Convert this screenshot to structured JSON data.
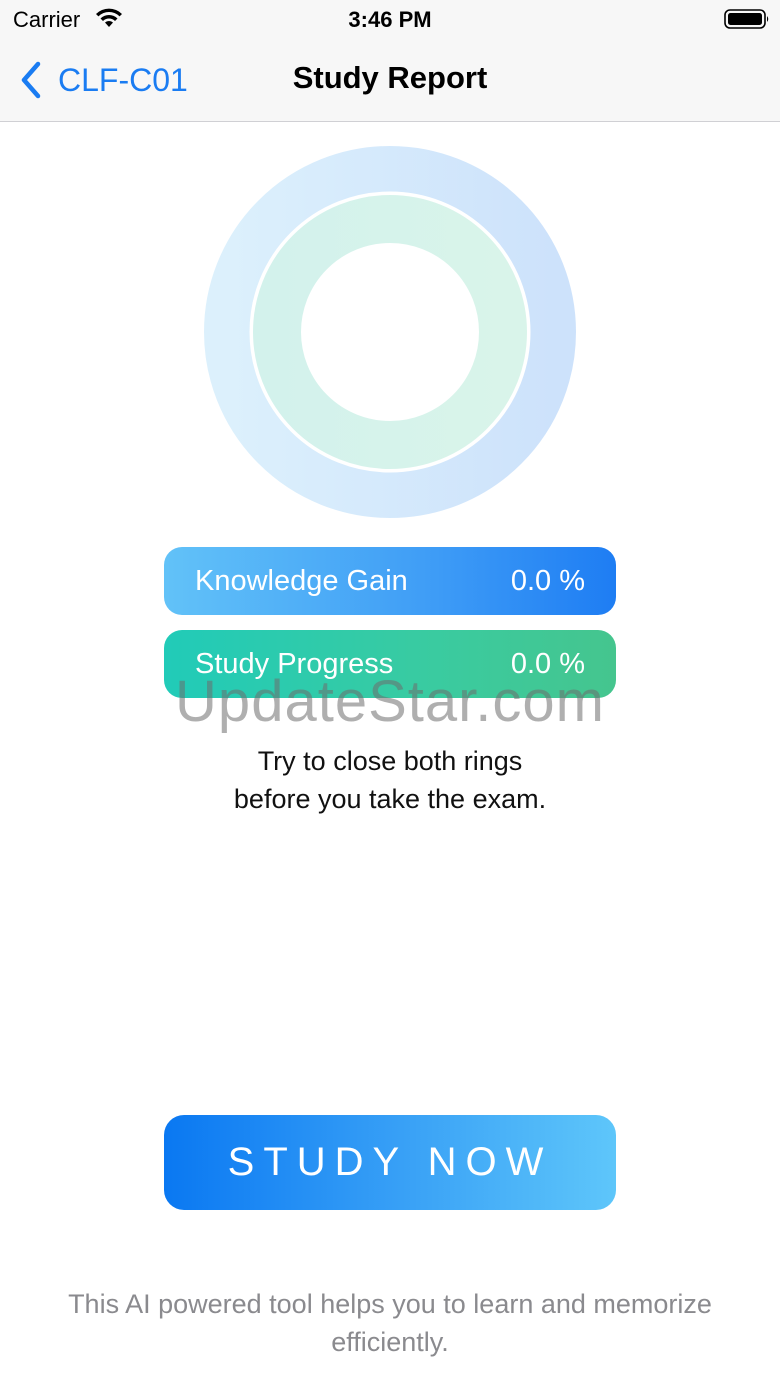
{
  "status_bar": {
    "carrier": "Carrier",
    "time": "3:46 PM",
    "wifi_icon": "wifi-icon",
    "battery_icon": "battery-icon"
  },
  "nav": {
    "back_label": "CLF-C01",
    "back_icon": "chevron-left-icon",
    "title": "Study Report",
    "accent_color": "#1a7cf2"
  },
  "rings": {
    "knowledge_gain_fraction": 0.0,
    "study_progress_fraction": 0.0,
    "outer_ring_color": "#cfe6fb",
    "inner_ring_color": "#d4f3ea"
  },
  "stats": [
    {
      "label": "Knowledge Gain",
      "value": "0.0 %",
      "color": "#3e9cf6"
    },
    {
      "label": "Study Progress",
      "value": "0.0 %",
      "color": "#2fcbab"
    }
  ],
  "hint": {
    "line1": "Try to close both rings",
    "line2": "before you take the exam."
  },
  "watermark": "UpdateStar.com",
  "study_now": {
    "label": "STUDY NOW"
  },
  "footer": {
    "line1": "This AI powered tool helps you to learn and memorize",
    "line2": "efficiently."
  }
}
